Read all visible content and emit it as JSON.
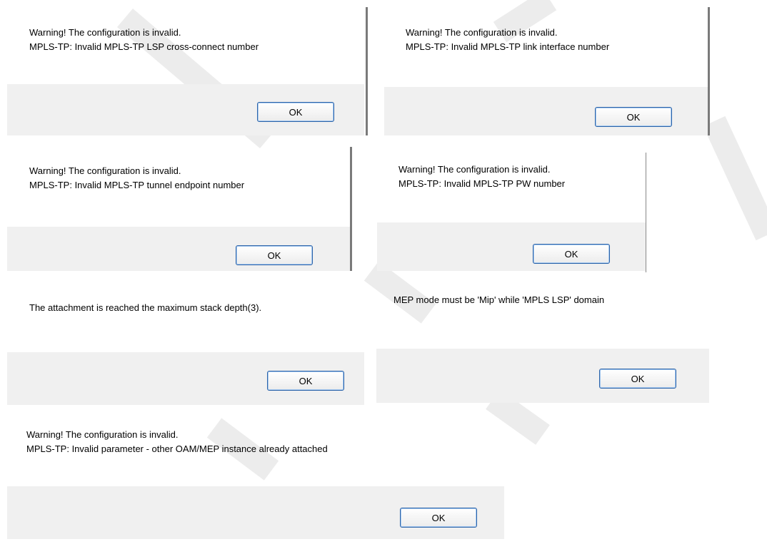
{
  "dialogs": [
    {
      "line1": "Warning! The configuration is invalid.",
      "line2": "MPLS-TP: Invalid MPLS-TP LSP cross-connect number",
      "ok_label": "OK"
    },
    {
      "line1": "Warning! The configuration is invalid.",
      "line2": "MPLS-TP: Invalid MPLS-TP link interface number",
      "ok_label": "OK"
    },
    {
      "line1": "Warning! The configuration is invalid.",
      "line2": "MPLS-TP: Invalid MPLS-TP tunnel endpoint number",
      "ok_label": "OK"
    },
    {
      "line1": "Warning! The configuration is invalid.",
      "line2": "MPLS-TP: Invalid MPLS-TP PW number",
      "ok_label": "OK"
    },
    {
      "line1": "The attachment is reached the maximum stack depth(3).",
      "ok_label": "OK"
    },
    {
      "line1": "MEP mode must be 'Mip' while 'MPLS LSP' domain",
      "ok_label": "OK"
    },
    {
      "line1": "Warning! The configuration is invalid.",
      "line2": "MPLS-TP: Invalid parameter - other OAM/MEP instance already attached",
      "ok_label": "OK"
    }
  ],
  "colors": {
    "footer": "#f0f0f0",
    "button_border": "#2c63a8",
    "watermark": "#ececec"
  }
}
